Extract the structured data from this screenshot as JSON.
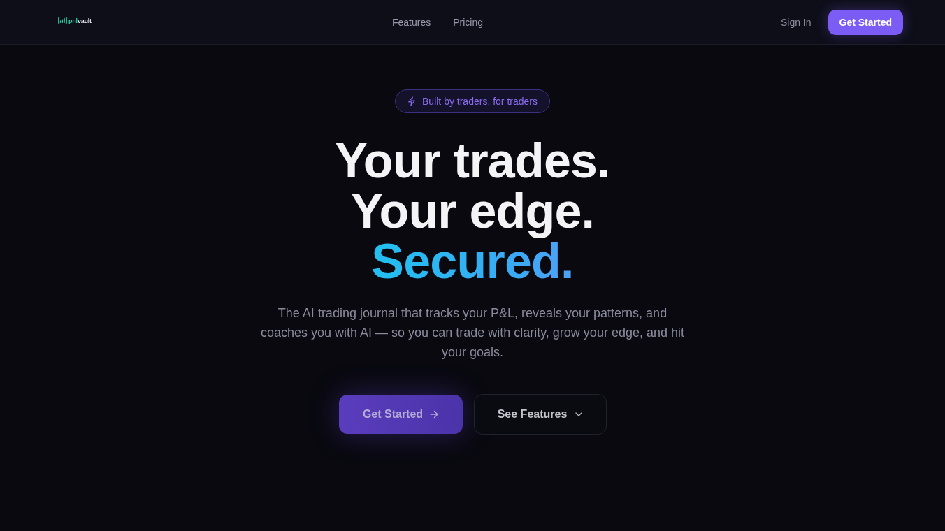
{
  "nav": {
    "logo": {
      "parts": [
        "pnl",
        "vault"
      ]
    },
    "links": [
      "Features",
      "Pricing"
    ],
    "sign_in": "Sign In",
    "cta": "Get Started"
  },
  "hero": {
    "badge": "Built by traders, for traders",
    "headline": [
      "Your trades.",
      "Your edge."
    ],
    "highlight": "Secured.",
    "subtitle": "The AI trading journal that tracks your P&L, reveals your patterns, and coaches you with AI — so you can trade with clarity, grow your edge, and hit your goals.",
    "primary": "Get Started",
    "secondary": "See Features"
  }
}
